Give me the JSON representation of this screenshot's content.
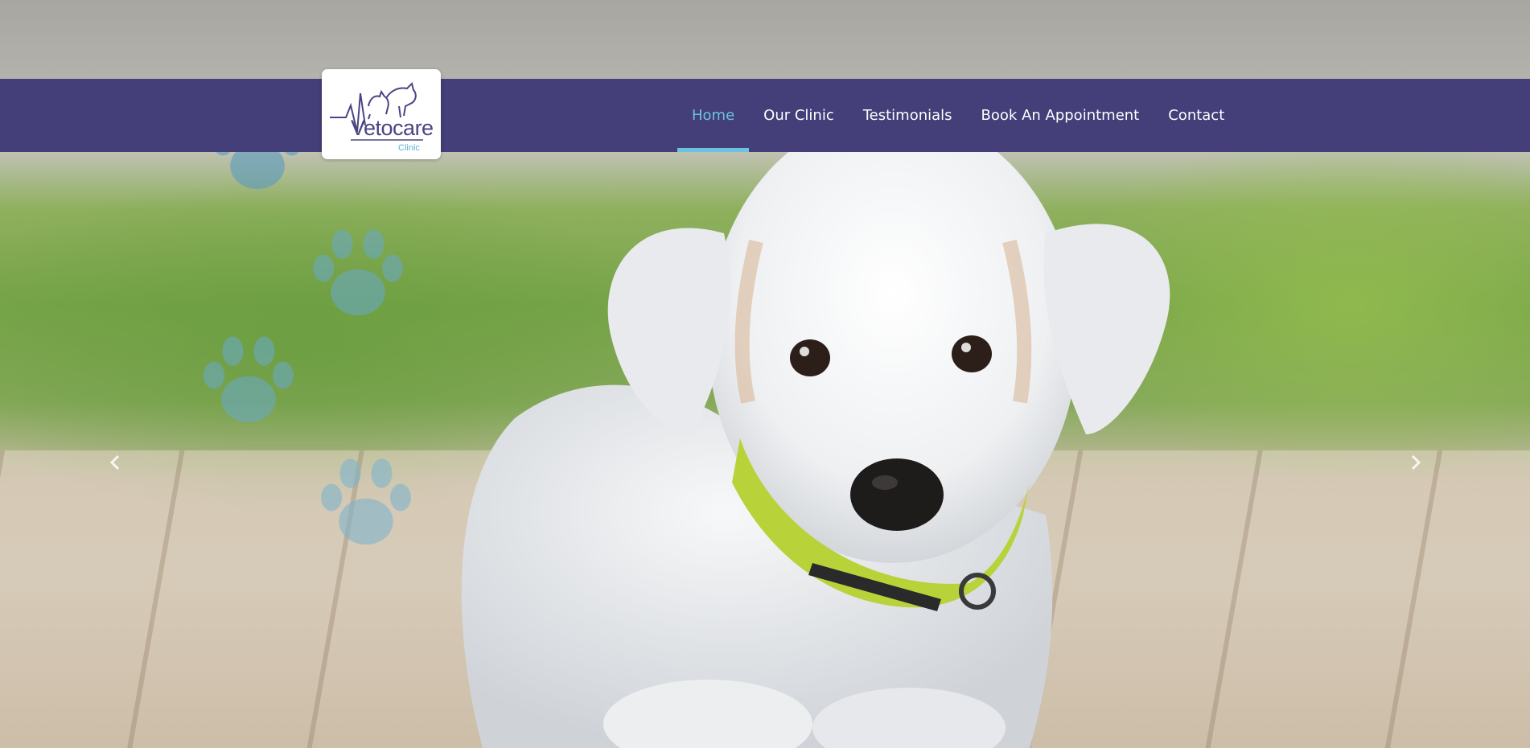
{
  "brand": {
    "logo_name": "Vetocare",
    "logo_subtitle": "Clinic",
    "colors": {
      "navbar": "#443e79",
      "active": "#6cc3e0",
      "nav_text": "#ffffff",
      "logo_text": "#4a4482",
      "logo_subtitle": "#5bb3d6",
      "paw": "#6aa9c2"
    }
  },
  "nav": {
    "items": [
      {
        "label": "Home",
        "active": true
      },
      {
        "label": "Our Clinic",
        "active": false
      },
      {
        "label": "Testimonials",
        "active": false
      },
      {
        "label": "Book An Appointment",
        "active": false
      },
      {
        "label": "Contact",
        "active": false
      }
    ]
  },
  "hero": {
    "image": "white-puppy-with-green-collar",
    "decorations": [
      "paw-icon",
      "paw-icon",
      "paw-icon",
      "paw-icon"
    ]
  },
  "carousel": {
    "prev_icon": "chevron-left-icon",
    "next_icon": "chevron-right-icon"
  }
}
